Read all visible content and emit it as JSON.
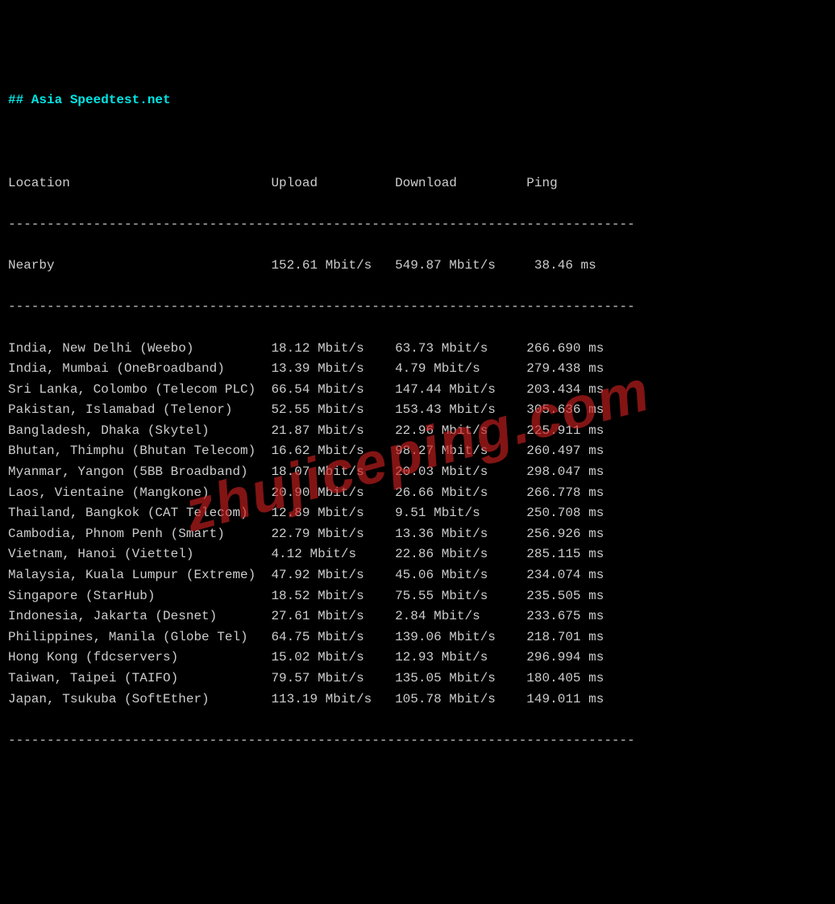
{
  "title": "## Asia Speedtest.net",
  "divider": "---------------------------------------------------------------------------------",
  "headers": {
    "location": "Location",
    "upload": "Upload",
    "download": "Download",
    "ping": "Ping"
  },
  "nearby": {
    "location": "Nearby",
    "upload": "152.61 Mbit/s",
    "download": "549.87 Mbit/s",
    "ping": "38.46 ms"
  },
  "rows": [
    {
      "location": "India, New Delhi (Weebo)",
      "upload": "18.12 Mbit/s",
      "download": "63.73 Mbit/s",
      "ping": "266.690 ms"
    },
    {
      "location": "India, Mumbai (OneBroadband)",
      "upload": "13.39 Mbit/s",
      "download": "4.79 Mbit/s",
      "ping": "279.438 ms"
    },
    {
      "location": "Sri Lanka, Colombo (Telecom PLC)",
      "upload": "66.54 Mbit/s",
      "download": "147.44 Mbit/s",
      "ping": "203.434 ms"
    },
    {
      "location": "Pakistan, Islamabad (Telenor)",
      "upload": "52.55 Mbit/s",
      "download": "153.43 Mbit/s",
      "ping": "305.636 ms"
    },
    {
      "location": "Bangladesh, Dhaka (Skytel)",
      "upload": "21.87 Mbit/s",
      "download": "22.96 Mbit/s",
      "ping": "225.911 ms"
    },
    {
      "location": "Bhutan, Thimphu (Bhutan Telecom)",
      "upload": "16.62 Mbit/s",
      "download": "98.27 Mbit/s",
      "ping": "260.497 ms"
    },
    {
      "location": "Myanmar, Yangon (5BB Broadband)",
      "upload": "18.07 Mbit/s",
      "download": "20.03 Mbit/s",
      "ping": "298.047 ms"
    },
    {
      "location": "Laos, Vientaine (Mangkone)",
      "upload": "20.90 Mbit/s",
      "download": "26.66 Mbit/s",
      "ping": "266.778 ms"
    },
    {
      "location": "Thailand, Bangkok (CAT Telecom)",
      "upload": "12.89 Mbit/s",
      "download": "9.51 Mbit/s",
      "ping": "250.708 ms"
    },
    {
      "location": "Cambodia, Phnom Penh (Smart)",
      "upload": "22.79 Mbit/s",
      "download": "13.36 Mbit/s",
      "ping": "256.926 ms"
    },
    {
      "location": "Vietnam, Hanoi (Viettel)",
      "upload": "4.12 Mbit/s",
      "download": "22.86 Mbit/s",
      "ping": "285.115 ms"
    },
    {
      "location": "Malaysia, Kuala Lumpur (Extreme)",
      "upload": "47.92 Mbit/s",
      "download": "45.06 Mbit/s",
      "ping": "234.074 ms"
    },
    {
      "location": "Singapore (StarHub)",
      "upload": "18.52 Mbit/s",
      "download": "75.55 Mbit/s",
      "ping": "235.505 ms"
    },
    {
      "location": "Indonesia, Jakarta (Desnet)",
      "upload": "27.61 Mbit/s",
      "download": "2.84 Mbit/s",
      "ping": "233.675 ms"
    },
    {
      "location": "Philippines, Manila (Globe Tel)",
      "upload": "64.75 Mbit/s",
      "download": "139.06 Mbit/s",
      "ping": "218.701 ms"
    },
    {
      "location": "Hong Kong (fdcservers)",
      "upload": "15.02 Mbit/s",
      "download": "12.93 Mbit/s",
      "ping": "296.994 ms"
    },
    {
      "location": "Taiwan, Taipei (TAIFO)",
      "upload": "79.57 Mbit/s",
      "download": "135.05 Mbit/s",
      "ping": "180.405 ms"
    },
    {
      "location": "Japan, Tsukuba (SoftEther)",
      "upload": "113.19 Mbit/s",
      "download": "105.78 Mbit/s",
      "ping": "149.011 ms"
    }
  ],
  "watermark": "zhujiceping.com",
  "columns": {
    "location_width": 34,
    "upload_width": 16,
    "download_width": 17,
    "ping_offset_nearby": 1
  }
}
